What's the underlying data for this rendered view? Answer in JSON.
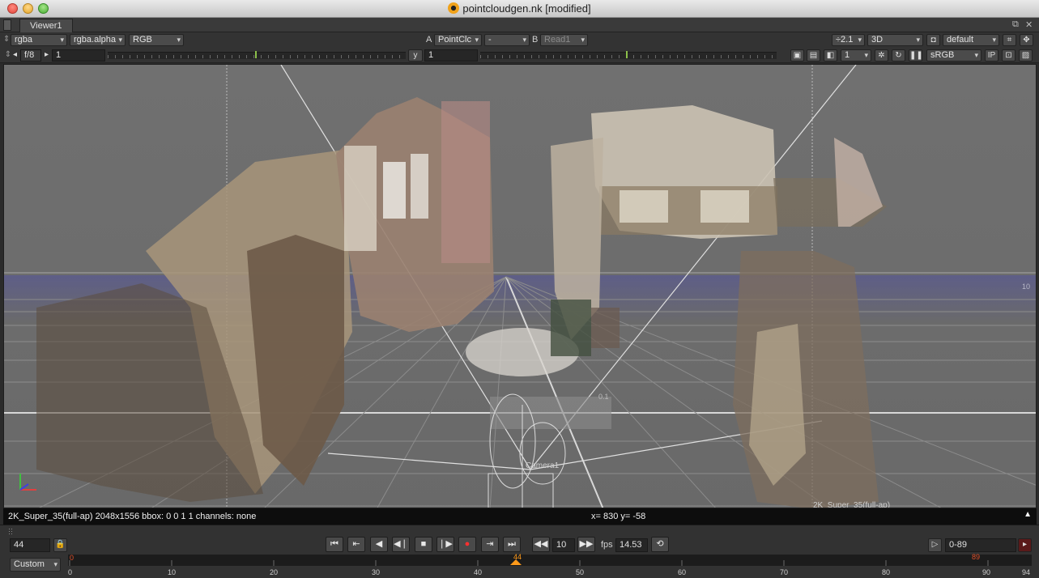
{
  "window": {
    "title": "pointcloudgen.nk [modified]"
  },
  "tab": {
    "label": "Viewer1"
  },
  "toolbar1": {
    "channels": "rgba",
    "alpha": "rgba.alpha",
    "display": "RGB",
    "a_label": "A",
    "input_a": "PointClc",
    "wipe": "-",
    "b_label": "B",
    "input_b": "Read1",
    "zoom": "÷2.1",
    "view_mode": "3D",
    "lut": "default"
  },
  "toolbar2": {
    "fstop": "f/8",
    "gain": "1",
    "y_label": "y",
    "gamma": "1",
    "proxy": "1",
    "colorspace": "sRGB",
    "ip_label": "IP"
  },
  "viewer": {
    "camera_label": "Camera1",
    "format_label": "2K_Super_35(full-ap)",
    "grid_label_a": "10",
    "grid_label_b": "0.1"
  },
  "infobar": {
    "left": "2K_Super_35(full-ap) 2048x1556 bbox: 0 0 1 1 channels: none",
    "coords": "x= 830 y= -58"
  },
  "playback": {
    "current_frame": "44",
    "increment": "10",
    "fps_label": "fps",
    "fps": "14.53",
    "range": "0-89",
    "range_mode": "Custom",
    "marker_current": "44",
    "marker_out": "89",
    "marker_in": "0"
  },
  "timeline": {
    "ticks": [
      "0",
      "10",
      "20",
      "30",
      "40",
      "50",
      "60",
      "70",
      "80",
      "90",
      "94"
    ]
  }
}
